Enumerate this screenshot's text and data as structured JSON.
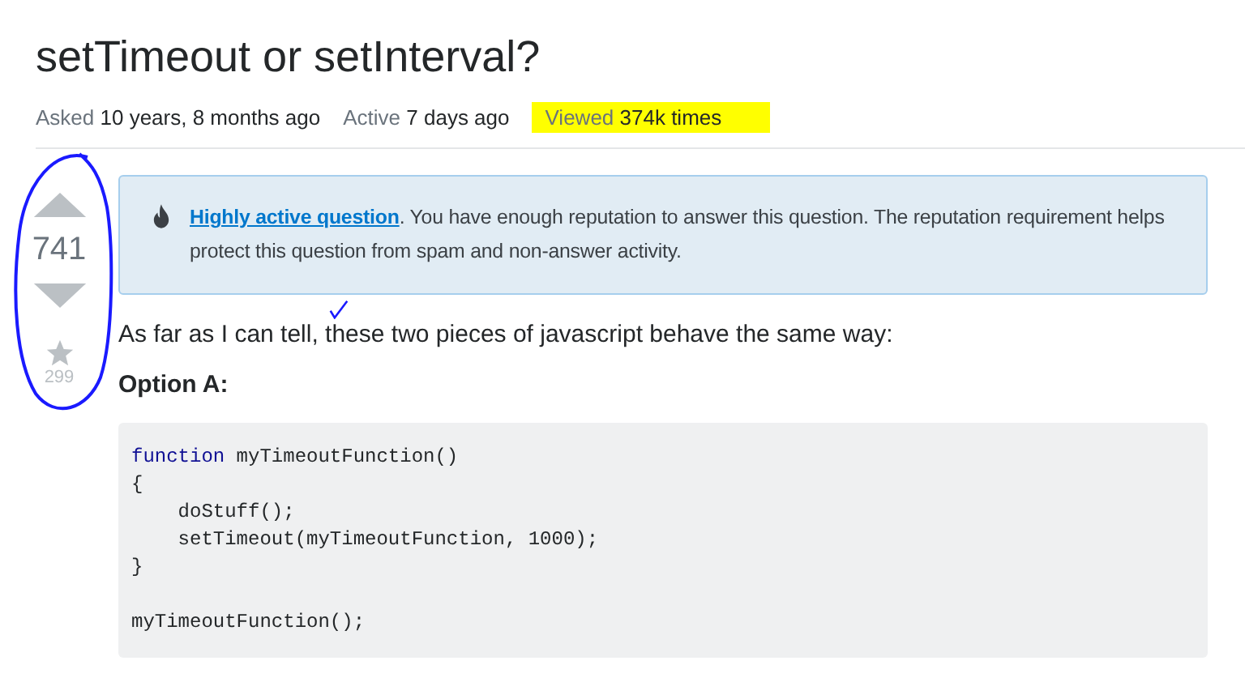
{
  "question": {
    "title": "setTimeout or setInterval?"
  },
  "stats": [
    {
      "label": "Asked",
      "value": "10 years, 8 months ago",
      "highlighted": false
    },
    {
      "label": "Active",
      "value": "7 days ago",
      "highlighted": false
    },
    {
      "label": "Viewed",
      "value": "374k times",
      "highlighted": true
    }
  ],
  "votes": {
    "score": "741",
    "bookmarks": "299"
  },
  "notice": {
    "link": "Highly active question",
    "text": ". You have enough reputation to answer this question. The reputation requirement helps protect this question from spam and non-answer activity."
  },
  "body": {
    "paragraph": "As far as I can tell, these two pieces of javascript behave the same way:",
    "heading": "Option A:",
    "code": [
      [
        {
          "text": "function",
          "kind": "keyword"
        },
        {
          "text": " myTimeoutFunction()",
          "kind": "plain"
        }
      ],
      [
        {
          "text": "{",
          "kind": "plain"
        }
      ],
      [
        {
          "text": "    doStuff();",
          "kind": "plain"
        }
      ],
      [
        {
          "text": "    setTimeout(myTimeoutFunction, 1000);",
          "kind": "plain"
        }
      ],
      [
        {
          "text": "}",
          "kind": "plain"
        }
      ],
      [
        {
          "text": "myTimeoutFunction();",
          "kind": "plain",
          "gap_before": true
        }
      ]
    ]
  }
}
